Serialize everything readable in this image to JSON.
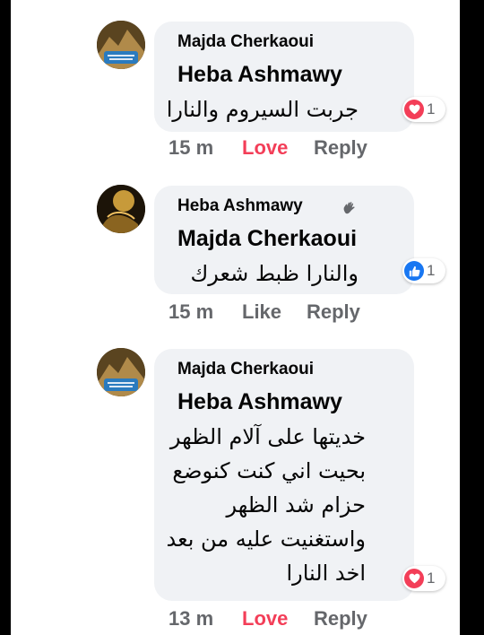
{
  "comments": [
    {
      "author": "Majda Cherkaoui",
      "mention": "Heba Ashmawy",
      "lines": [
        "جربت السيروم والنارا"
      ],
      "reaction": {
        "type": "love-icon",
        "count": "1",
        "color": "#f33e58"
      },
      "time": "15 m",
      "action": "Love",
      "reply": "Reply"
    },
    {
      "author": "Heba Ashmawy",
      "mention": "Majda Cherkaoui",
      "lines": [
        "والنارا ظبط شعرك"
      ],
      "reaction": {
        "type": "like-icon",
        "count": "1",
        "color": "#1877f2"
      },
      "time": "15 m",
      "action": "Like",
      "reply": "Reply"
    },
    {
      "author": "Majda Cherkaoui",
      "mention": "Heba Ashmawy",
      "lines": [
        "خديتها على آلام الظهر",
        "بحيت اني كنت كنوضع",
        "حزام شد الظهر",
        "واستغنيت عليه من بعد",
        "اخد النارا"
      ],
      "reaction": {
        "type": "love-icon",
        "count": "1",
        "color": "#f33e58"
      },
      "time": "13 m",
      "action": "Love",
      "reply": "Reply"
    }
  ]
}
